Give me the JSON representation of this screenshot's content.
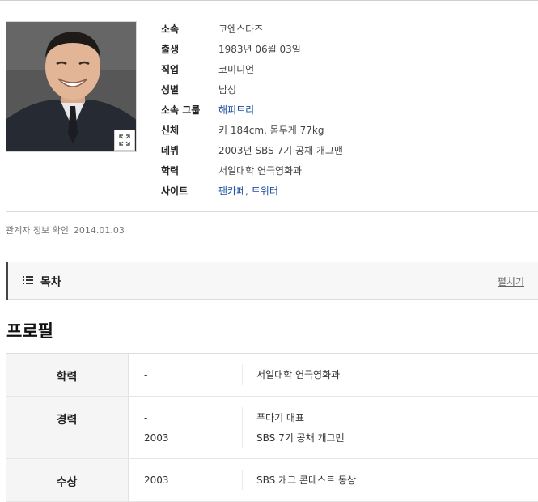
{
  "profile": {
    "photo_alt": "",
    "info": [
      {
        "label": "소속",
        "value": "코엔스타즈"
      },
      {
        "label": "출생",
        "value": "1983년 06월 03일"
      },
      {
        "label": "직업",
        "value": "코미디언"
      },
      {
        "label": "성별",
        "value": "남성"
      },
      {
        "label": "소속 그룹",
        "value": "해피트리"
      },
      {
        "label": "신체",
        "value": "키 184cm, 몸무게 77kg"
      },
      {
        "label": "데뷔",
        "value": "2003년 SBS 7기 공채 개그맨"
      },
      {
        "label": "학력",
        "value": "서일대학 연극영화과"
      },
      {
        "label": "사이트",
        "link1": "팬카페",
        "sep": ", ",
        "link2": "트위터"
      }
    ],
    "verify_text": "관계자 정보 확인",
    "verify_date": "2014.01.03"
  },
  "toc": {
    "title": "목차",
    "toggle": "펼치기"
  },
  "section": {
    "title": "프로필"
  },
  "table": [
    {
      "category": "학력",
      "entries": [
        {
          "year": "-",
          "desc": "서일대학 연극영화과"
        }
      ]
    },
    {
      "category": "경력",
      "entries": [
        {
          "year": "-",
          "desc": "푸다기 대표"
        },
        {
          "year": "2003",
          "desc": "SBS 7기 공채 개그맨"
        }
      ]
    },
    {
      "category": "수상",
      "entries": [
        {
          "year": "2003",
          "desc": "SBS 개그 콘테스트 동상"
        }
      ]
    }
  ],
  "colors": {
    "link": "#1a4fa0",
    "toc_accent": "#444444",
    "category_bg": "#f5f5f5"
  }
}
